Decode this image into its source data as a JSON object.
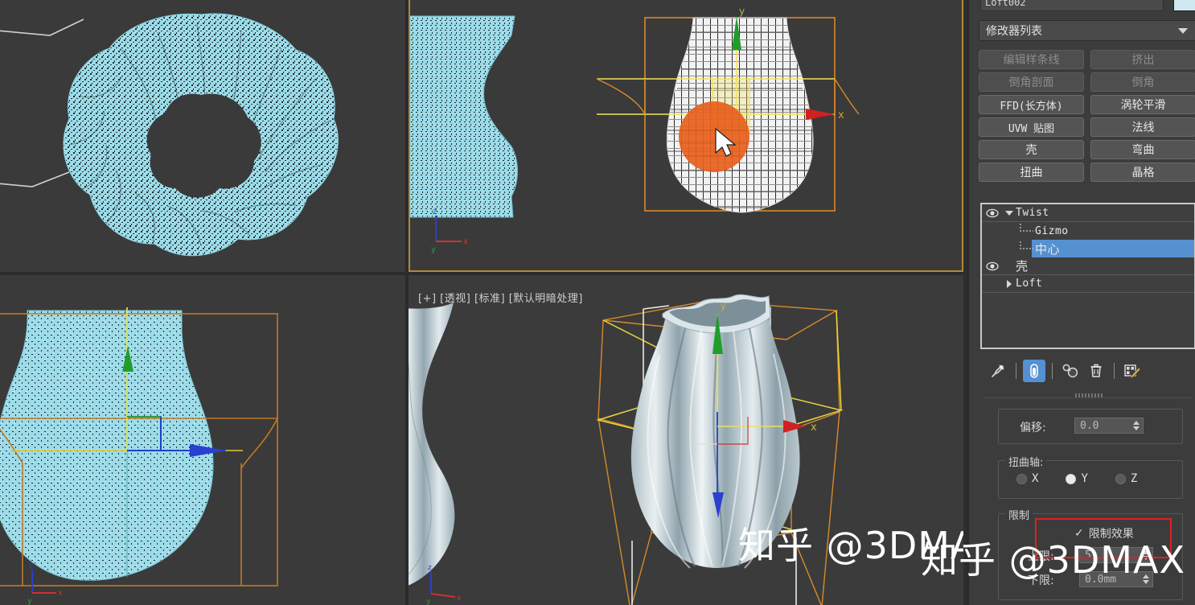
{
  "viewports": {
    "top_left": {
      "label": "",
      "object": "twisted-torus-wireframe"
    },
    "top_mid": {
      "label": "",
      "object": "vase-front-shaded-wire"
    },
    "top_right": {
      "label": "",
      "object": "vase-wireframe-with-gizmo"
    },
    "bottom_left": {
      "label": "",
      "object": "vase-front-selected"
    },
    "bottom_right": {
      "label": "[+] [透视] [标准] [默认明暗处理]",
      "object": "vase-perspective-shaded"
    }
  },
  "command_panel": {
    "object_name": "Loft002",
    "color_swatch": "#cfe8f2",
    "modifier_list_label": "修改器列表",
    "modifier_buttons": [
      {
        "label": "编辑样条线",
        "enabled": false,
        "mono": false
      },
      {
        "label": "挤出",
        "enabled": false,
        "mono": false
      },
      {
        "label": "倒角剖面",
        "enabled": false,
        "mono": false
      },
      {
        "label": "倒角",
        "enabled": false,
        "mono": false
      },
      {
        "label": "FFD(长方体)",
        "enabled": true,
        "mono": true
      },
      {
        "label": "涡轮平滑",
        "enabled": true,
        "mono": false
      },
      {
        "label": "UVW 贴图",
        "enabled": true,
        "mono": true
      },
      {
        "label": "法线",
        "enabled": true,
        "mono": false
      },
      {
        "label": "壳",
        "enabled": true,
        "mono": false
      },
      {
        "label": "弯曲",
        "enabled": true,
        "mono": false
      },
      {
        "label": "扭曲",
        "enabled": true,
        "mono": false
      },
      {
        "label": "晶格",
        "enabled": true,
        "mono": false
      }
    ],
    "modifier_stack": [
      {
        "label": "Twist",
        "eye": true,
        "expanded": true,
        "level": 0,
        "selected": false,
        "cjk": false
      },
      {
        "label": "Gizmo",
        "eye": false,
        "expanded": false,
        "level": 1,
        "selected": false,
        "cjk": false
      },
      {
        "label": "中心",
        "eye": false,
        "expanded": false,
        "level": 1,
        "selected": true,
        "cjk": true
      },
      {
        "label": "壳",
        "eye": true,
        "expanded": false,
        "level": 0,
        "selected": false,
        "cjk": true
      },
      {
        "label": "Loft",
        "eye": false,
        "expanded": false,
        "level": 0,
        "selected": false,
        "cjk": false,
        "collapsed_arrow": true
      }
    ],
    "stack_toolbar": [
      {
        "name": "pin-stack-icon",
        "active": false
      },
      {
        "name": "show-end-result-icon",
        "active": true
      },
      {
        "name": "make-unique-icon",
        "active": false
      },
      {
        "name": "remove-modifier-icon",
        "active": false
      },
      {
        "name": "configure-modifier-sets-icon",
        "active": false
      }
    ],
    "parameters": {
      "offset_label": "偏移:",
      "offset_value": "0.0",
      "twist_axis_group": "扭曲轴:",
      "axis_options": [
        {
          "label": "X",
          "selected": false
        },
        {
          "label": "Y",
          "selected": true
        },
        {
          "label": "Z",
          "selected": false
        }
      ],
      "limits_group": "限制",
      "limit_effect_label": "限制效果",
      "limit_effect_checked": true,
      "upper_limit_label": "上限:",
      "upper_limit_value": "5",
      "lower_limit_label": "下限:",
      "lower_limit_value": "0.0mm"
    }
  },
  "watermark": {
    "text": "知乎 @3DMAX"
  }
}
